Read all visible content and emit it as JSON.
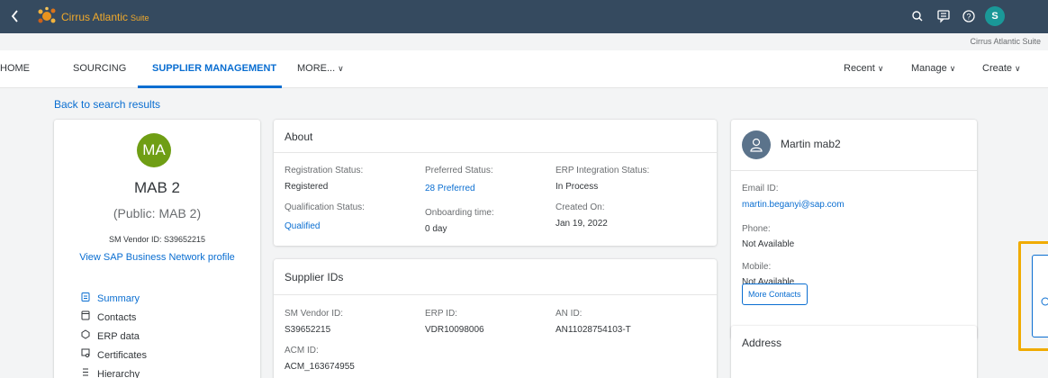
{
  "shell": {
    "brand": "Cirrus Atlantic",
    "brand_suffix": "Suite",
    "avatar_initial": "S",
    "icons": [
      "back-icon",
      "search-icon",
      "feedback-icon",
      "help-icon"
    ]
  },
  "suite_label": "Cirrus Atlantic Suite",
  "nav": {
    "home": "HOME",
    "sourcing": "SOURCING",
    "supplier_management": "SUPPLIER MANAGEMENT",
    "more": "MORE...",
    "recent": "Recent",
    "manage": "Manage",
    "create": "Create"
  },
  "back_link": "Back to search results",
  "profile": {
    "initials": "MA",
    "name": "MAB 2",
    "public_name": "(Public: MAB 2)",
    "vendor_id": "SM Vendor ID: S39652215",
    "network_link": "View SAP Business Network profile",
    "menu": [
      {
        "label": "Summary",
        "icon": "summary-icon"
      },
      {
        "label": "Contacts",
        "icon": "contacts-icon"
      },
      {
        "label": "ERP data",
        "icon": "erp-icon"
      },
      {
        "label": "Certificates",
        "icon": "certificate-icon"
      },
      {
        "label": "Hierarchy",
        "icon": "hierarchy-icon"
      }
    ]
  },
  "about": {
    "title": "About",
    "registration_status_label": "Registration Status:",
    "registration_status": "Registered",
    "preferred_status_label": "Preferred Status:",
    "preferred_status": "28 Preferred",
    "erp_status_label": "ERP Integration Status:",
    "erp_status": "In Process",
    "qualification_status_label": "Qualification Status:",
    "qualification_status": "Qualified",
    "onboarding_label": "Onboarding time:",
    "onboarding": "0 day",
    "created_label": "Created On:",
    "created": "Jan 19, 2022"
  },
  "supplier_ids": {
    "title": "Supplier IDs",
    "sm_vendor_label": "SM Vendor ID:",
    "sm_vendor": "S39652215",
    "erp_label": "ERP ID:",
    "erp": "VDR10098006",
    "an_label": "AN ID:",
    "an": "AN11028754103-T",
    "acm_label": "ACM ID:",
    "acm": "ACM_163674955"
  },
  "contact": {
    "name": "Martin mab2",
    "email_label": "Email ID:",
    "email": "martin.beganyi@sap.com",
    "phone_label": "Phone:",
    "phone": "Not Available",
    "mobile_label": "Mobile:",
    "mobile": "Not Available",
    "more_button": "More Contacts"
  },
  "address": {
    "title": "Address"
  },
  "colors": {
    "shell": "#354a5f",
    "accent": "#0a6ed1",
    "brand": "#f0a92b",
    "avatar_ma": "#6f9e14",
    "avatar_s": "#1a9898",
    "highlight": "#f0ab00"
  }
}
